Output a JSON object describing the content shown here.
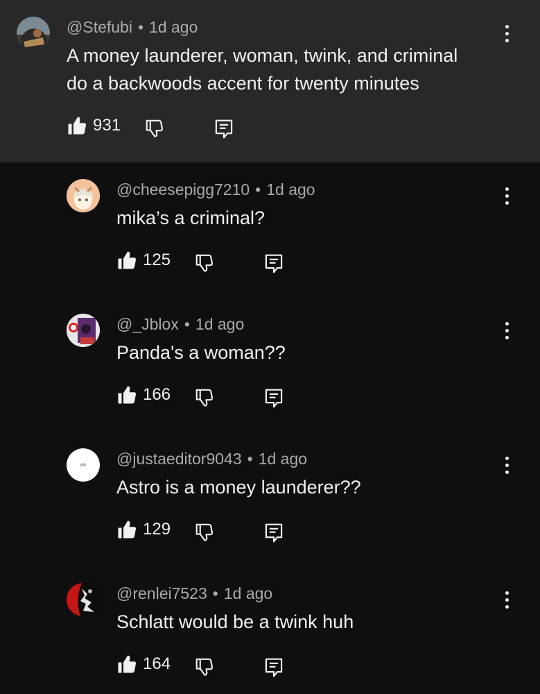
{
  "comments": [
    {
      "handle": "@Stefubi",
      "time": "1d ago",
      "text_lines": [
        "A money launderer, woman, twink, and criminal",
        "do a backwoods accent for twenty minutes"
      ],
      "likes": "931",
      "avatar_icon": "avatar-image"
    },
    {
      "handle": "@cheesepigg7210",
      "time": "1d ago",
      "text_lines": [
        "mika’s a criminal?"
      ],
      "likes": "125",
      "avatar_icon": "avatar-image"
    },
    {
      "handle": "@_Jblox",
      "time": "1d ago",
      "text_lines": [
        "Panda's a woman??"
      ],
      "likes": "166",
      "avatar_icon": "avatar-image"
    },
    {
      "handle": "@justaeditor9043",
      "time": "1d ago",
      "text_lines": [
        "Astro is a money launderer??"
      ],
      "likes": "129",
      "avatar_icon": "avatar-image",
      "avatar_text": "idk"
    },
    {
      "handle": "@renlei7523",
      "time": "1d ago",
      "text_lines": [
        "Schlatt would be a twink huh"
      ],
      "likes": "164",
      "avatar_icon": "avatar-image"
    }
  ],
  "separator": "•",
  "colors": {
    "background": "#0f0f0f",
    "highlight": "#282828",
    "meta": "#aaaaaa",
    "text": "#f1f1f1"
  }
}
